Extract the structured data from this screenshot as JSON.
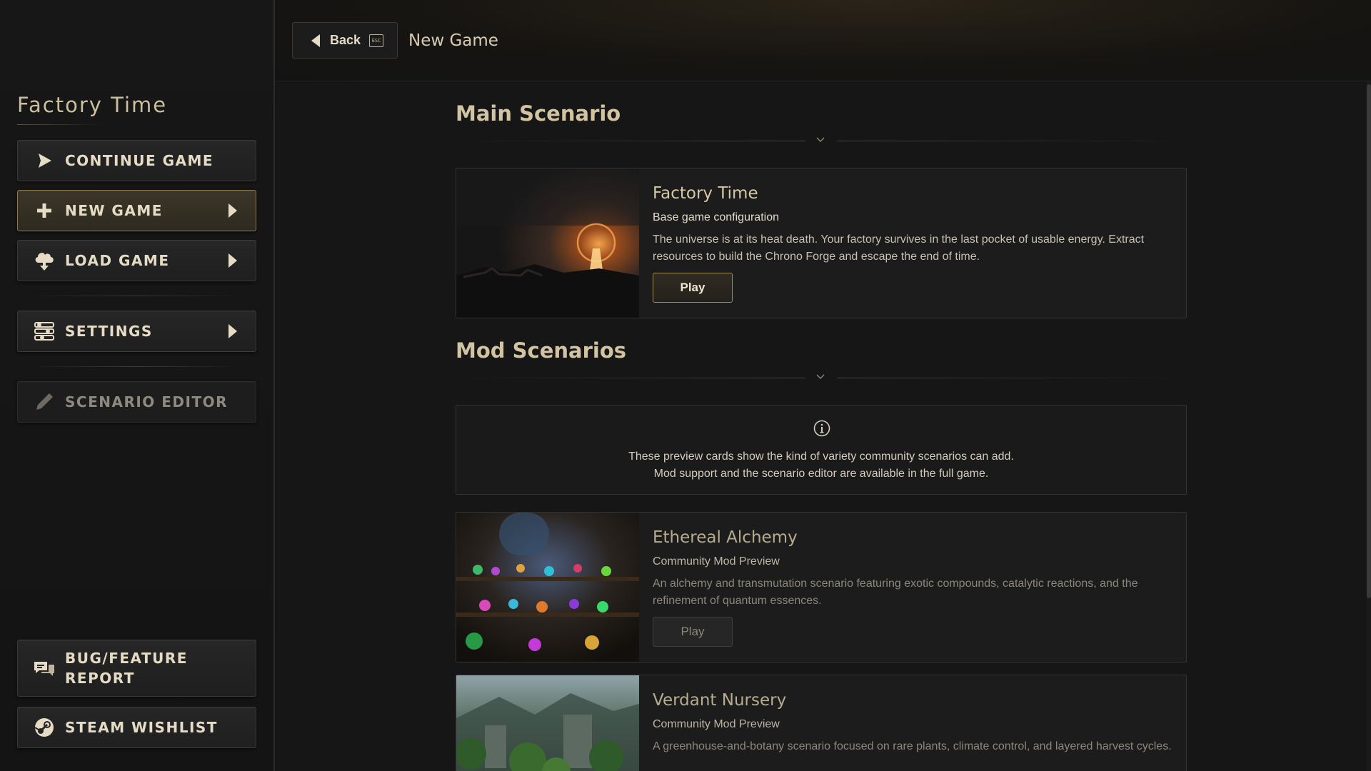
{
  "sidebar": {
    "app_title": "Factory Time",
    "menu": {
      "continue": "CONTINUE GAME",
      "new_game": "NEW GAME",
      "load_game": "LOAD GAME",
      "settings": "SETTINGS",
      "scenario_editor": "SCENARIO EDITOR",
      "bug_report": "BUG/FEATURE\nREPORT",
      "wishlist": "STEAM WISHLIST"
    },
    "active_item": "new_game",
    "disabled_item": "scenario_editor"
  },
  "topbar": {
    "back_label": "Back",
    "back_key_hint": "ESC",
    "title": "New Game"
  },
  "main_scenario": {
    "heading": "Main Scenario",
    "card": {
      "title": "Factory Time",
      "subtitle": "Base game configuration",
      "description": "The universe is at its heat death. Your factory survives in the last pocket of usable energy. Extract resources to build the Chrono Forge and escape the end of time.",
      "play_label": "Play"
    }
  },
  "mod_scenarios": {
    "heading": "Mod Scenarios",
    "info_line1": "These preview cards show the kind of variety community scenarios can add.",
    "info_line2": "Mod support and the scenario editor are available in the full game.",
    "cards": [
      {
        "title": "Ethereal Alchemy",
        "subtitle": "Community Mod Preview",
        "description": "An alchemy and transmutation scenario featuring exotic compounds, catalytic reactions, and the refinement of quantum essences.",
        "play_label": "Play"
      },
      {
        "title": "Verdant Nursery",
        "subtitle": "Community Mod Preview",
        "description": "A greenhouse-and-botany scenario focused on rare plants, climate control, and layered harvest cycles."
      }
    ]
  },
  "colors": {
    "accent_gold": "#a08d5d",
    "background": "#151515",
    "text_primary": "#d8cdb4"
  }
}
